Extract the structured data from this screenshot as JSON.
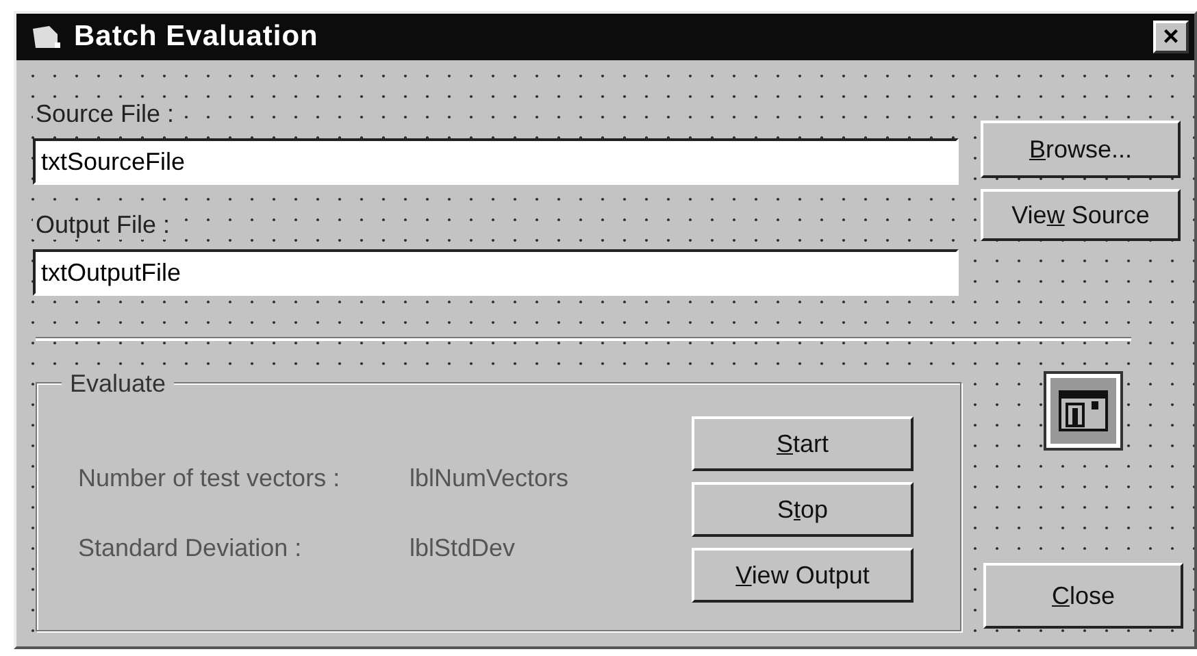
{
  "window": {
    "title": "Batch Evaluation",
    "close_glyph": "×"
  },
  "source": {
    "label": "Source File :",
    "value": "txtSourceFile"
  },
  "output": {
    "label": "Output File :",
    "value": "txtOutputFile"
  },
  "side_buttons": [
    {
      "key": "B",
      "after": "rowse..."
    },
    {
      "before": "Vie",
      "key": "w",
      "after": " Source"
    }
  ],
  "evaluate": {
    "title": "Evaluate",
    "rows": [
      {
        "label": "Number of test vectors :",
        "value": "lblNumVectors"
      },
      {
        "label": "Standard Deviation :",
        "value": "lblStdDev"
      }
    ],
    "buttons": [
      {
        "key": "S",
        "after": "tart"
      },
      {
        "before": "S",
        "key": "t",
        "after": "op"
      },
      {
        "key": "V",
        "after": "iew Output"
      }
    ]
  },
  "close_button": {
    "key": "C",
    "after": "lose"
  }
}
